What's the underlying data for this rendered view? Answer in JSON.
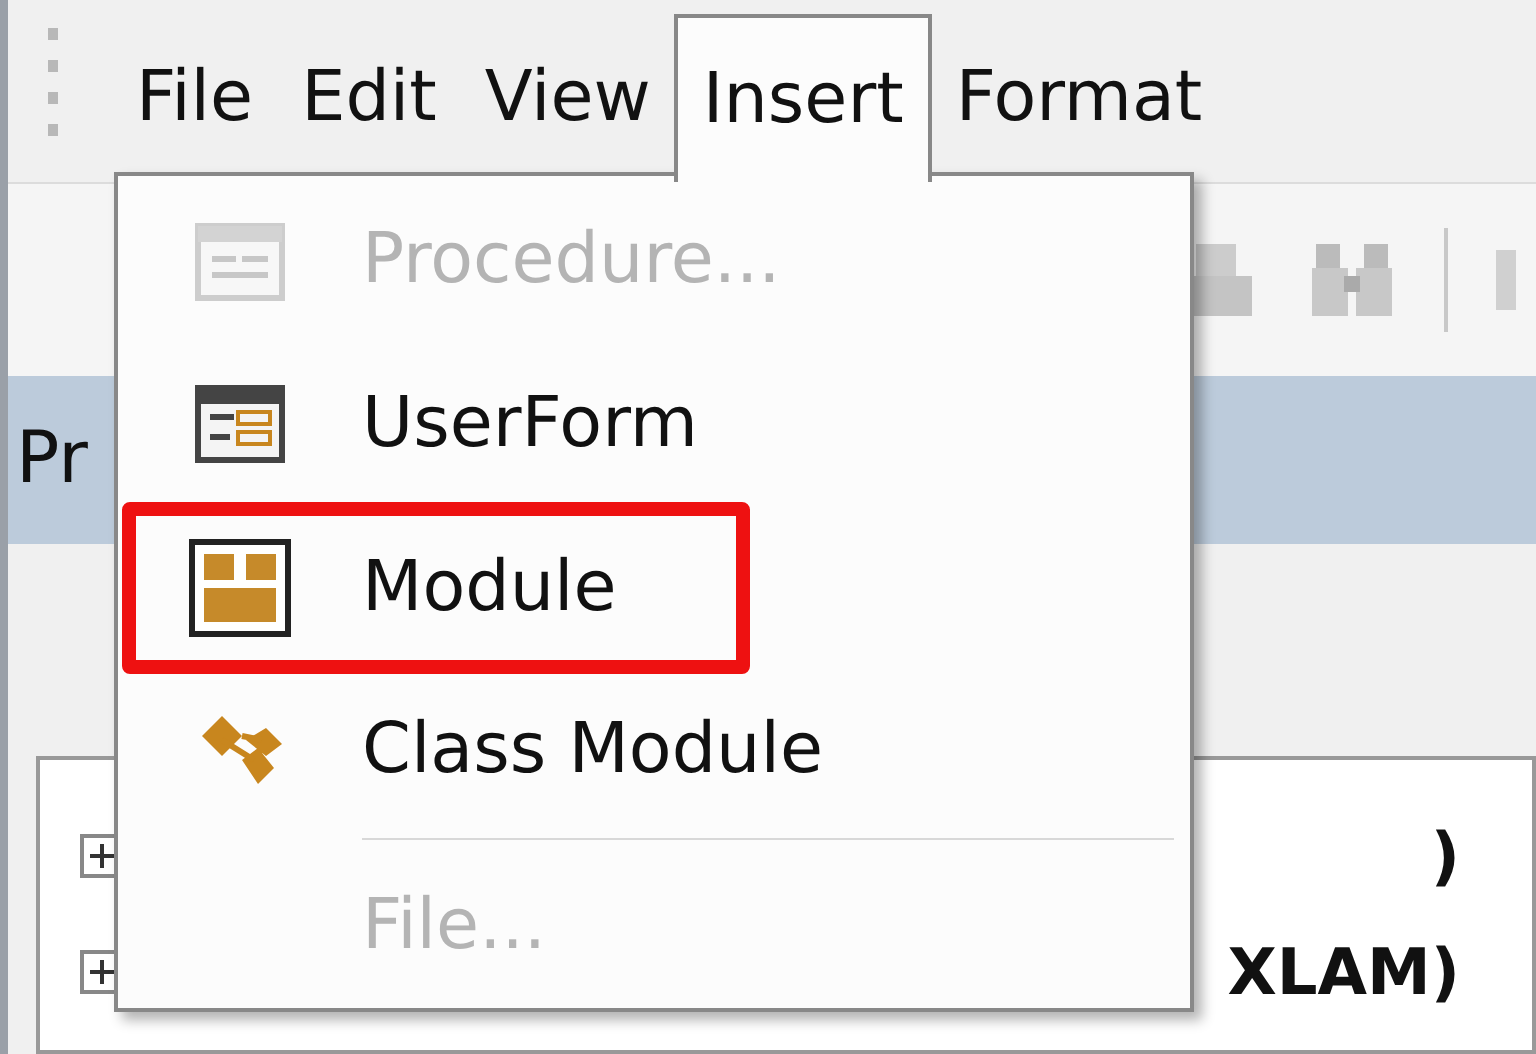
{
  "menu_bar": [
    {
      "label": "File",
      "selected": false
    },
    {
      "label": "Edit",
      "selected": false
    },
    {
      "label": "View",
      "selected": false
    },
    {
      "label": "Insert",
      "selected": true
    },
    {
      "label": "Format",
      "selected": false
    }
  ],
  "project_panel": {
    "title": "Pr",
    "tree": [
      {
        "label": ")"
      },
      {
        "label": "XLAM)"
      }
    ]
  },
  "insert_menu": [
    {
      "kind": "procedure",
      "label": "Procedure...",
      "disabled": true,
      "highlighted": false
    },
    {
      "kind": "userform",
      "label": "UserForm",
      "disabled": false,
      "highlighted": false
    },
    {
      "kind": "module",
      "label": "Module",
      "disabled": false,
      "highlighted": true
    },
    {
      "kind": "class",
      "label": "Class Module",
      "disabled": false,
      "highlighted": false
    },
    {
      "kind": "separator"
    },
    {
      "kind": "file",
      "label": "File...",
      "disabled": true,
      "highlighted": false
    }
  ]
}
